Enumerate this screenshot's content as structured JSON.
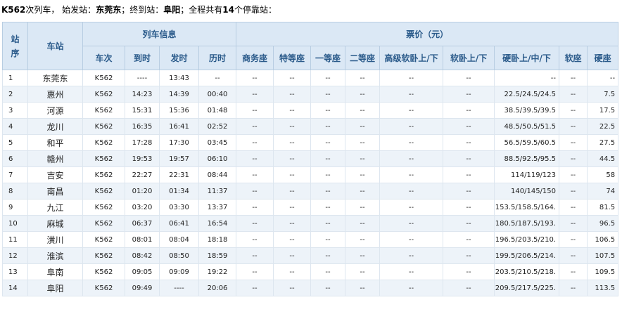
{
  "summary": {
    "train": "K562",
    "text1": "次列车，  始发站：",
    "origin": "东莞东",
    "text2": "；终到站：",
    "terminal": "阜阳",
    "text3": "；全程共有",
    "stops": "14",
    "text4": "个停靠站："
  },
  "header": {
    "seq": "站序",
    "station": "车站",
    "train_info": "列车信息",
    "fares": "票价（元）",
    "train_no": "车次",
    "arrive": "到时",
    "depart": "发时",
    "elapsed": "历时",
    "business": "商务座",
    "special": "特等座",
    "first": "一等座",
    "second": "二等座",
    "deluxe_soft_sleeper": "高级软卧上/下",
    "soft_sleeper": "软卧上/下",
    "hard_sleeper": "硬卧上/中/下",
    "soft_seat": "软座",
    "hard_seat": "硬座"
  },
  "rows": [
    {
      "seq": "1",
      "station": "东莞东",
      "train": "K562",
      "arrive": "----",
      "depart": "13:43",
      "elapsed": "--",
      "business": "--",
      "special": "--",
      "first": "--",
      "second": "--",
      "deluxe": "--",
      "soft_sleeper": "--",
      "hard_sleeper": "--",
      "soft_seat": "--",
      "hard_seat": "--"
    },
    {
      "seq": "2",
      "station": "惠州",
      "train": "K562",
      "arrive": "14:23",
      "depart": "14:39",
      "elapsed": "00:40",
      "business": "--",
      "special": "--",
      "first": "--",
      "second": "--",
      "deluxe": "--",
      "soft_sleeper": "--",
      "hard_sleeper": "22.5/24.5/24.5",
      "soft_seat": "--",
      "hard_seat": "7.5"
    },
    {
      "seq": "3",
      "station": "河源",
      "train": "K562",
      "arrive": "15:31",
      "depart": "15:36",
      "elapsed": "01:48",
      "business": "--",
      "special": "--",
      "first": "--",
      "second": "--",
      "deluxe": "--",
      "soft_sleeper": "--",
      "hard_sleeper": "38.5/39.5/39.5",
      "soft_seat": "--",
      "hard_seat": "17.5"
    },
    {
      "seq": "4",
      "station": "龙川",
      "train": "K562",
      "arrive": "16:35",
      "depart": "16:41",
      "elapsed": "02:52",
      "business": "--",
      "special": "--",
      "first": "--",
      "second": "--",
      "deluxe": "--",
      "soft_sleeper": "--",
      "hard_sleeper": "48.5/50.5/51.5",
      "soft_seat": "--",
      "hard_seat": "22.5"
    },
    {
      "seq": "5",
      "station": "和平",
      "train": "K562",
      "arrive": "17:28",
      "depart": "17:30",
      "elapsed": "03:45",
      "business": "--",
      "special": "--",
      "first": "--",
      "second": "--",
      "deluxe": "--",
      "soft_sleeper": "--",
      "hard_sleeper": "56.5/59.5/60.5",
      "soft_seat": "--",
      "hard_seat": "27.5"
    },
    {
      "seq": "6",
      "station": "赣州",
      "train": "K562",
      "arrive": "19:53",
      "depart": "19:57",
      "elapsed": "06:10",
      "business": "--",
      "special": "--",
      "first": "--",
      "second": "--",
      "deluxe": "--",
      "soft_sleeper": "--",
      "hard_sleeper": "88.5/92.5/95.5",
      "soft_seat": "--",
      "hard_seat": "44.5"
    },
    {
      "seq": "7",
      "station": "吉安",
      "train": "K562",
      "arrive": "22:27",
      "depart": "22:31",
      "elapsed": "08:44",
      "business": "--",
      "special": "--",
      "first": "--",
      "second": "--",
      "deluxe": "--",
      "soft_sleeper": "--",
      "hard_sleeper": "114/119/123",
      "soft_seat": "--",
      "hard_seat": "58"
    },
    {
      "seq": "8",
      "station": "南昌",
      "train": "K562",
      "arrive": "01:20",
      "depart": "01:34",
      "elapsed": "11:37",
      "business": "--",
      "special": "--",
      "first": "--",
      "second": "--",
      "deluxe": "--",
      "soft_sleeper": "--",
      "hard_sleeper": "140/145/150",
      "soft_seat": "--",
      "hard_seat": "74"
    },
    {
      "seq": "9",
      "station": "九江",
      "train": "K562",
      "arrive": "03:20",
      "depart": "03:30",
      "elapsed": "13:37",
      "business": "--",
      "special": "--",
      "first": "--",
      "second": "--",
      "deluxe": "--",
      "soft_sleeper": "--",
      "hard_sleeper": "153.5/158.5/164.",
      "soft_seat": "--",
      "hard_seat": "81.5"
    },
    {
      "seq": "10",
      "station": "麻城",
      "train": "K562",
      "arrive": "06:37",
      "depart": "06:41",
      "elapsed": "16:54",
      "business": "--",
      "special": "--",
      "first": "--",
      "second": "--",
      "deluxe": "--",
      "soft_sleeper": "--",
      "hard_sleeper": "180.5/187.5/193.",
      "soft_seat": "--",
      "hard_seat": "96.5"
    },
    {
      "seq": "11",
      "station": "潢川",
      "train": "K562",
      "arrive": "08:01",
      "depart": "08:04",
      "elapsed": "18:18",
      "business": "--",
      "special": "--",
      "first": "--",
      "second": "--",
      "deluxe": "--",
      "soft_sleeper": "--",
      "hard_sleeper": "196.5/203.5/210.",
      "soft_seat": "--",
      "hard_seat": "106.5"
    },
    {
      "seq": "12",
      "station": "淮滨",
      "train": "K562",
      "arrive": "08:42",
      "depart": "08:50",
      "elapsed": "18:59",
      "business": "--",
      "special": "--",
      "first": "--",
      "second": "--",
      "deluxe": "--",
      "soft_sleeper": "--",
      "hard_sleeper": "199.5/206.5/214.",
      "soft_seat": "--",
      "hard_seat": "107.5"
    },
    {
      "seq": "13",
      "station": "阜南",
      "train": "K562",
      "arrive": "09:05",
      "depart": "09:09",
      "elapsed": "19:22",
      "business": "--",
      "special": "--",
      "first": "--",
      "second": "--",
      "deluxe": "--",
      "soft_sleeper": "--",
      "hard_sleeper": "203.5/210.5/218.",
      "soft_seat": "--",
      "hard_seat": "109.5"
    },
    {
      "seq": "14",
      "station": "阜阳",
      "train": "K562",
      "arrive": "09:49",
      "depart": "----",
      "elapsed": "20:06",
      "business": "--",
      "special": "--",
      "first": "--",
      "second": "--",
      "deluxe": "--",
      "soft_sleeper": "--",
      "hard_sleeper": "209.5/217.5/225.",
      "soft_seat": "--",
      "hard_seat": "113.5"
    }
  ]
}
